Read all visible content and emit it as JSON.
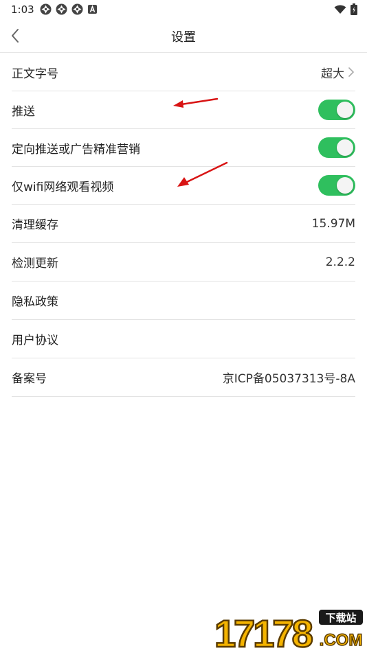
{
  "status_bar": {
    "time": "1:03",
    "notification_icons": [
      "aperture-icon",
      "aperture-icon",
      "aperture-icon",
      "a-badge-icon"
    ],
    "right_icons": [
      "wifi-icon",
      "battery-icon"
    ]
  },
  "header": {
    "title": "设置",
    "back_icon": "chevron-left-icon"
  },
  "settings": {
    "font_size": {
      "label": "正文字号",
      "value": "超大"
    },
    "push": {
      "label": "推送",
      "enabled": true
    },
    "targeted_ads": {
      "label": "定向推送或广告精准营销",
      "enabled": true
    },
    "wifi_only_video": {
      "label": "仅wifi网络观看视频",
      "enabled": true
    },
    "clear_cache": {
      "label": "清理缓存",
      "value": "15.97M"
    },
    "check_update": {
      "label": "检测更新",
      "value": "2.2.2"
    },
    "privacy_policy": {
      "label": "隐私政策"
    },
    "user_agreement": {
      "label": "用户协议"
    },
    "icp_record": {
      "label": "备案号",
      "value": "京ICP备05037313号-8A"
    }
  },
  "annotations": {
    "arrow_color": "#d81414"
  },
  "watermark": {
    "number": "17178",
    "tag": "下载站",
    "domain": ".COM"
  },
  "colors": {
    "toggle_on": "#2fbf5e",
    "divider": "#e3e3e3",
    "text": "#222222"
  }
}
